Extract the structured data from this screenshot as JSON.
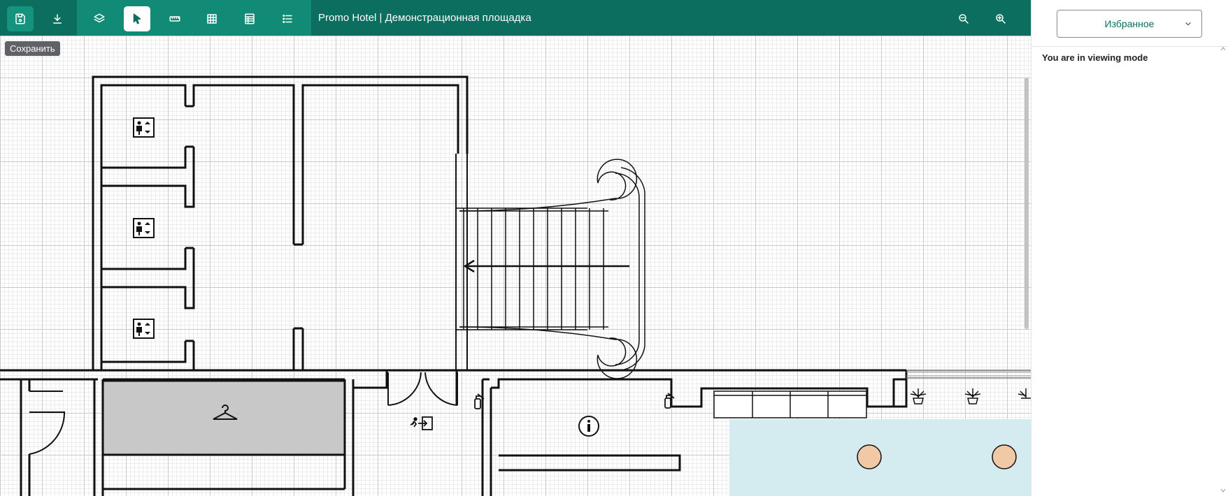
{
  "app": {
    "title": "Promo Hotel | Демонстрационная площадка"
  },
  "toolbar": {
    "save_tooltip": "Сохранить",
    "buttons": [
      {
        "icon": "save-icon",
        "active": true
      },
      {
        "icon": "download-icon"
      },
      {
        "icon": "layers-icon"
      },
      {
        "icon": "cursor-icon",
        "selected": true
      },
      {
        "icon": "ruler-icon"
      },
      {
        "icon": "grid-icon"
      },
      {
        "icon": "table-icon"
      },
      {
        "icon": "list-icon"
      }
    ],
    "zoom_out_icon": "zoom-out-icon",
    "zoom_in_icon": "zoom-in-icon"
  },
  "panel": {
    "favorites_label": "Избранное",
    "mode_message": "You are in viewing mode"
  },
  "colors": {
    "toolbar_dark": "#0b6e5e",
    "toolbar_mid": "#118a76",
    "wardrobe_fill": "#c8c8c8",
    "lounge_fill": "#d4ecf0",
    "table_fill": "#f2c9a6"
  }
}
